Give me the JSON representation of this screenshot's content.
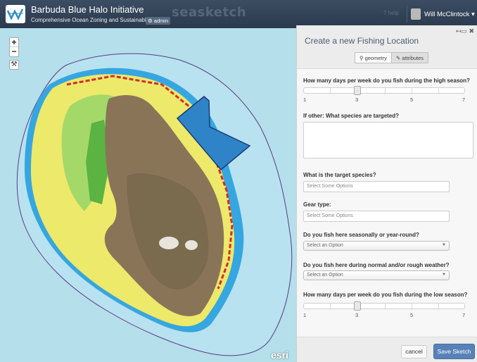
{
  "header": {
    "title": "Barbuda Blue Halo Initiative",
    "subtitle": "Comprehensive Ocean Zoning and Sustainable Fishing",
    "admin_badge": "⚙ admin",
    "brand": "seasketch",
    "help": "? help",
    "user_name": "Will McClintock ▾"
  },
  "map": {
    "zoom_in": "+",
    "zoom_out": "−",
    "tools_icon": "⚒",
    "attribution": "esri"
  },
  "panel": {
    "title": "Create a new Fishing Location",
    "tabs": [
      "⚲ geometry",
      "✎ attributes"
    ],
    "q1": "How many days per week do you fish during the high season?",
    "slider1": {
      "labels": [
        "1",
        "3",
        "5",
        "7"
      ],
      "value": 3
    },
    "q2": "If other: What species are targeted?",
    "q3": "What is the target species?",
    "species_placeholder": "Select Some Options",
    "q4": "Gear type:",
    "gear_placeholder": "Select Some Options",
    "q5": "Do you fish here seasonally or year-round?",
    "season_select": "Select an Option",
    "q6": "Do you fish here during normal and/or rough weather?",
    "weather_select": "Select an Option",
    "q7": "How many days per week do you fish during the low season?",
    "slider2": {
      "labels": [
        "1",
        "3",
        "5",
        "7"
      ],
      "value": 3
    },
    "cancel_label": "cancel",
    "save_label": "Save Sketch"
  }
}
